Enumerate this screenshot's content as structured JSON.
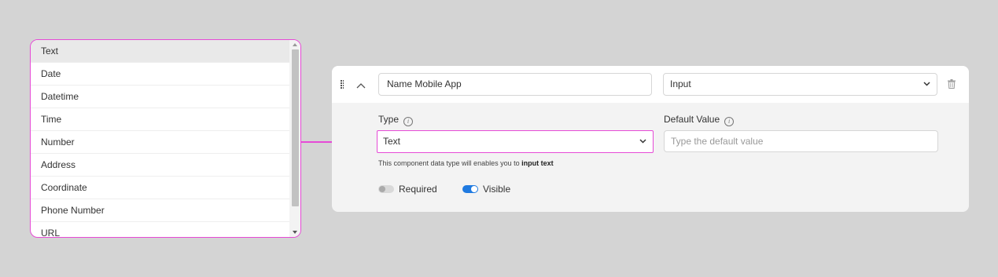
{
  "type_options": [
    "Text",
    "Date",
    "Datetime",
    "Time",
    "Number",
    "Address",
    "Coordinate",
    "Phone Number",
    "URL"
  ],
  "selected_option_index": 0,
  "component": {
    "name_value": "Name Mobile App",
    "component_type": "Input",
    "type_label": "Type",
    "type_value": "Text",
    "default_label": "Default Value",
    "default_placeholder": "Type the default value",
    "helper_prefix": "This component data type will enables you to",
    "helper_bold": "input text",
    "required_label": "Required",
    "required_on": false,
    "visible_label": "Visible",
    "visible_on": true
  },
  "colors": {
    "highlight": "#e64ad6",
    "toggle_on": "#1f7ae0"
  }
}
